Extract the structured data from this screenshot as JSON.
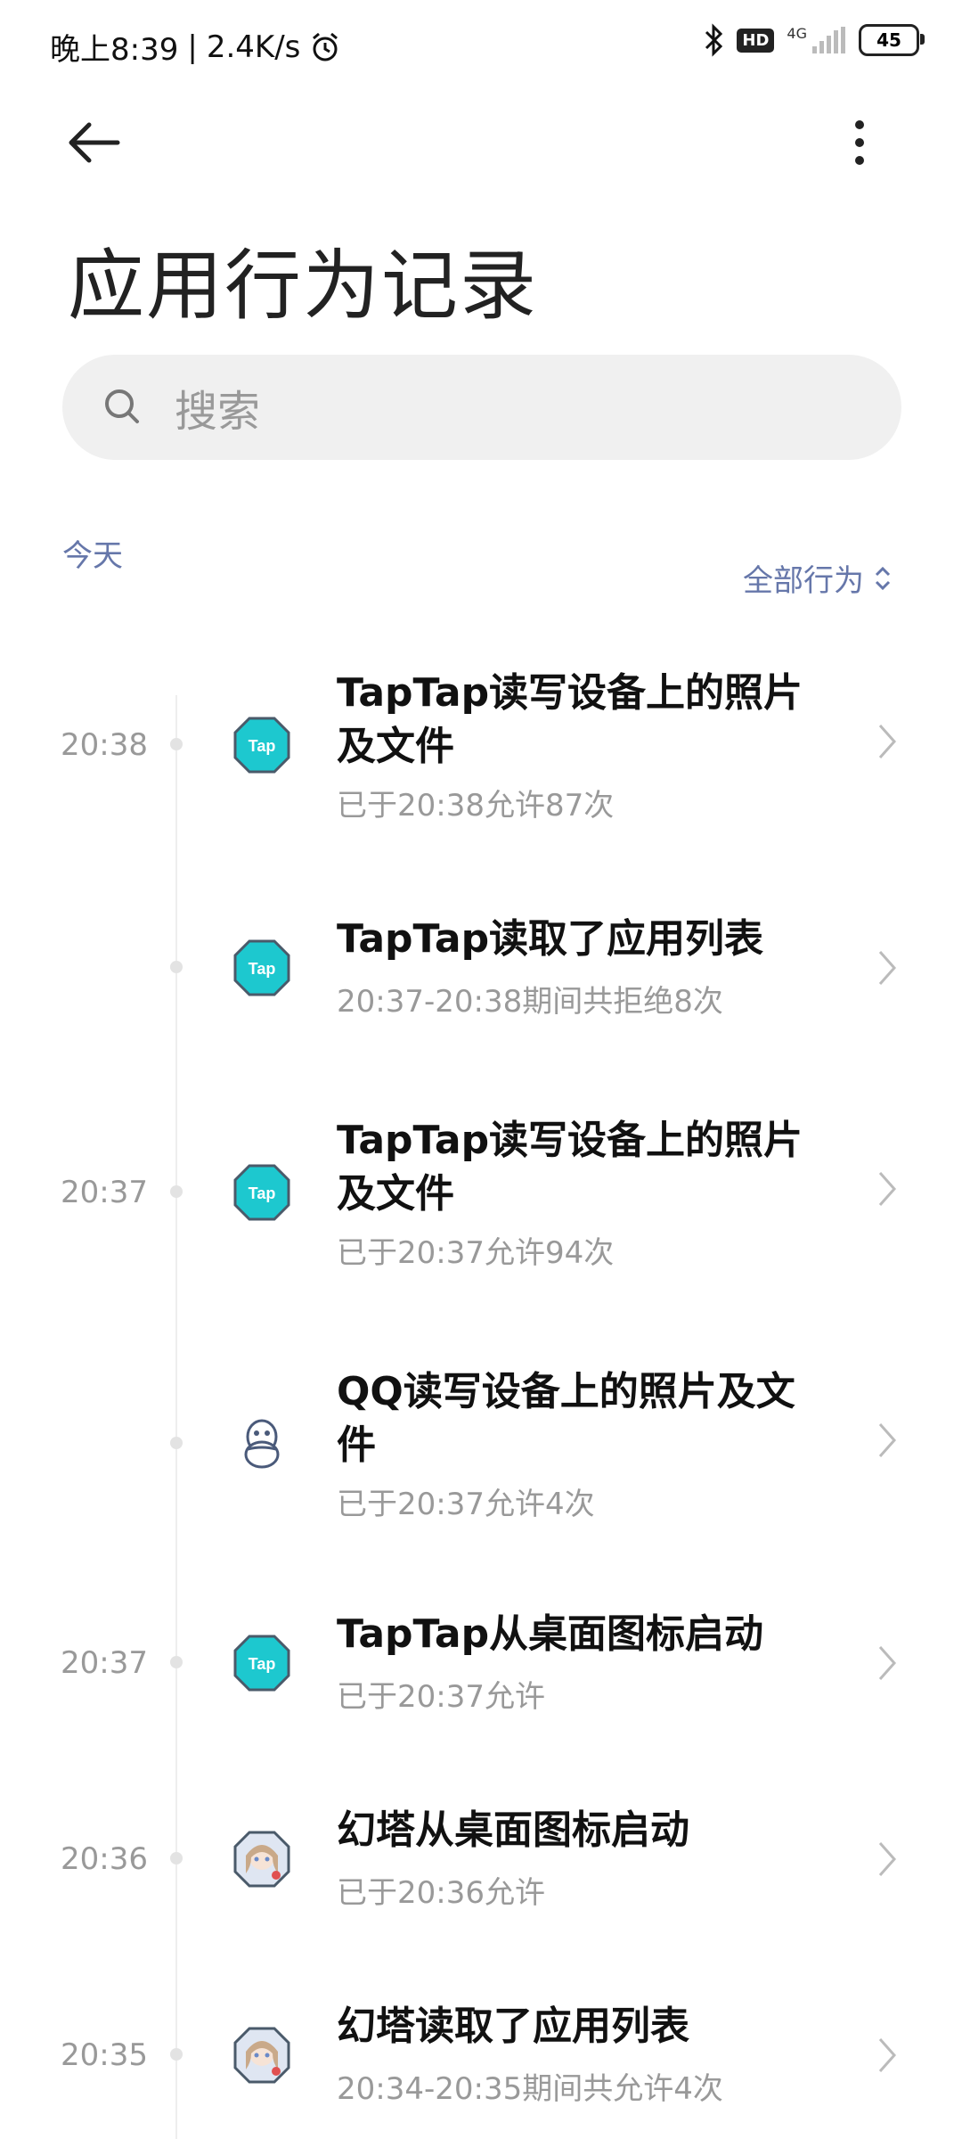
{
  "status_bar": {
    "time": "晚上8:39",
    "separator": "|",
    "speed": "2.4K/s",
    "hd": "HD",
    "network": "4G",
    "battery": "45"
  },
  "header": {
    "title": "应用行为记录",
    "search_placeholder": "搜索"
  },
  "section": {
    "date_label": "今天",
    "filter_label": "全部行为"
  },
  "entries": [
    {
      "time": "20:38",
      "icon": "taptap-icon",
      "title_line1": "TapTap读写设备上的照片",
      "title_line2": "及文件",
      "subtitle": "已于20:38允许87次"
    },
    {
      "time": "",
      "icon": "taptap-icon",
      "title_line1": "TapTap读取了应用列表",
      "title_line2": "",
      "subtitle": "20:37-20:38期间共拒绝8次"
    },
    {
      "time": "20:37",
      "icon": "taptap-icon",
      "title_line1": "TapTap读写设备上的照片",
      "title_line2": "及文件",
      "subtitle": "已于20:37允许94次"
    },
    {
      "time": "",
      "icon": "qq-icon",
      "title_line1": "QQ读写设备上的照片及文",
      "title_line2": "件",
      "subtitle": "已于20:37允许4次"
    },
    {
      "time": "20:37",
      "icon": "taptap-icon",
      "title_line1": "TapTap从桌面图标启动",
      "title_line2": "",
      "subtitle": "已于20:37允许"
    },
    {
      "time": "20:36",
      "icon": "huanta-icon",
      "title_line1": "幻塔从桌面图标启动",
      "title_line2": "",
      "subtitle": "已于20:36允许"
    },
    {
      "time": "20:35",
      "icon": "huanta-icon",
      "title_line1": "幻塔读取了应用列表",
      "title_line2": "",
      "subtitle": "20:34-20:35期间共允许4次"
    }
  ],
  "colors": {
    "accent_text": "#6677aa",
    "taptap": "#1dc8cf",
    "muted": "#999999"
  }
}
